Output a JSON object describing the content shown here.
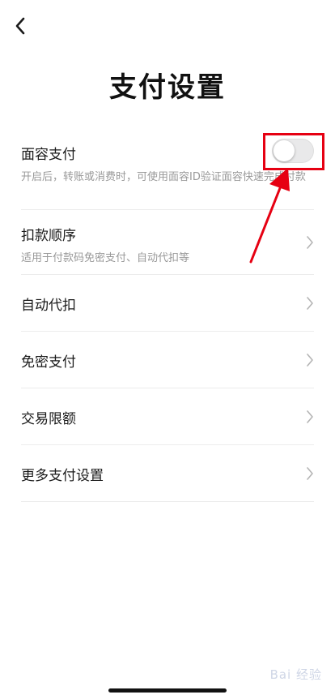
{
  "header": {
    "back_icon": "chevron-left-icon",
    "title": "支付设置"
  },
  "settings": {
    "face_pay": {
      "label": "面容支付",
      "description": "开启后，转账或消费时，可使用面容ID验证面容快速完成付款",
      "toggle_on": false
    },
    "deduction_order": {
      "label": "扣款顺序",
      "description": "适用于付款码免密支付、自动代扣等"
    },
    "auto_deduct": {
      "label": "自动代扣"
    },
    "password_free": {
      "label": "免密支付"
    },
    "transaction_limit": {
      "label": "交易限额"
    },
    "more_settings": {
      "label": "更多支付设置"
    }
  },
  "annotation": {
    "color": "#e60012"
  },
  "watermark": {
    "text": "Bai 经验"
  },
  "colors": {
    "toggle_off": "#e9e9ea",
    "description": "#999999",
    "divider": "#ececec"
  }
}
